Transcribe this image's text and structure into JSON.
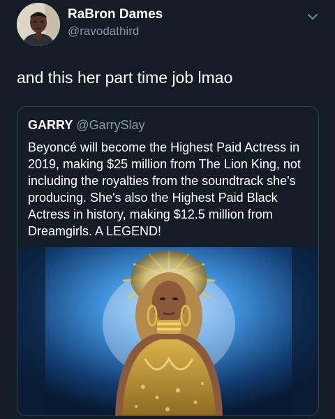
{
  "author": {
    "display_name": "RaBron Dames",
    "handle": "@ravodathird"
  },
  "tweet": {
    "text": "and this her part time job lmao"
  },
  "quoted_tweet": {
    "display_name": "GARRY",
    "handle": "@GarrySlay",
    "text": "Beyoncé will become the Highest Paid Actress in 2019, making $25 million from The Lion King, not including the royalties from the soundtrack she's producing. She's also the Highest Paid Black Actress in history, making $12.5 million from Dreamgirls. A LEGEND!"
  },
  "icons": {
    "more": "chevron-down-icon"
  },
  "colors": {
    "background": "#141d26",
    "secondary_text": "#8899a6",
    "border": "#38444d",
    "stage_light": "#2f7cc8",
    "gold": "#c9a13a"
  }
}
